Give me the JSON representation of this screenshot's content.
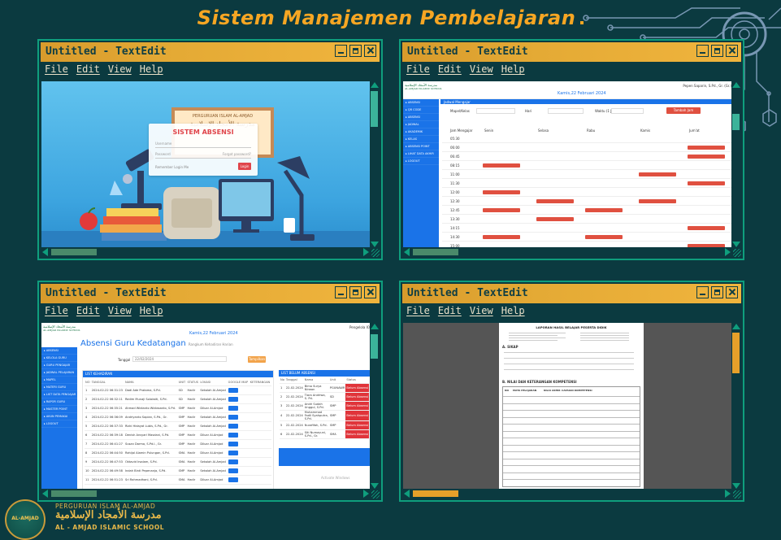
{
  "page": {
    "title": "Sistem Manajemen Pembelajaran"
  },
  "windows": [
    {
      "title": "Untitled - TextEdit",
      "menu": [
        "File",
        "Edit",
        "View",
        "Help"
      ]
    },
    {
      "title": "Untitled - TextEdit",
      "menu": [
        "File",
        "Edit",
        "View",
        "Help"
      ]
    },
    {
      "title": "Untitled - TextEdit",
      "menu": [
        "File",
        "Edit",
        "View",
        "Help"
      ]
    },
    {
      "title": "Untitled - TextEdit",
      "menu": [
        "File",
        "Edit",
        "View",
        "Help"
      ]
    }
  ],
  "login": {
    "cert_label": "PERGURUAN ISLAM AL-AMJAD",
    "cert_arabic": "مدرسة الأمجاد الإسلامية",
    "title": "SISTEM ABSENSI",
    "username_placeholder": "Username",
    "password_placeholder": "Password",
    "forgot": "Forgot password?",
    "remember": "Remember Login Me",
    "button": "Login"
  },
  "schedule": {
    "school_arabic": "مدرسة الأمجاد الإسلامية",
    "school_latin": "AL-AMJAD ISLAMIC SCHOOL",
    "date": "Kamis,22 Februari 2024",
    "user": "Pepen Saparin, S.Pd., Gr. (Gr.)",
    "tab": "Jadwal Mengajar",
    "filter_labels": [
      "Mapel/Kelas",
      "Hari",
      "Waktu (1 Jam)"
    ],
    "add_button": "Tambah Jam Mengajar",
    "columns": [
      "Jam Mengajar",
      "Senin",
      "Selasa",
      "Rabu",
      "Kamis",
      "Jum'at"
    ],
    "times": [
      "05:30",
      "06:00",
      "06:45",
      "08:15",
      "11:00",
      "11:30",
      "12:00",
      "12:30",
      "12:45",
      "13:30",
      "14:15",
      "14:30",
      "15:00"
    ],
    "sidebar": [
      "ABSENSI",
      "QR CODE",
      "ABSENSI",
      "JADWAL",
      "AKADEMIK",
      "KELAS",
      "ABSENSI POINT",
      "LIHAT DATA AKHIR",
      "LOGOUT"
    ]
  },
  "attendance": {
    "heading": "Absensi Guru Kedatangan",
    "subheading": "Rangkum Kehadiran Harian",
    "date": "Kamis,22 Februari 2024",
    "user": "Pengelola IO",
    "filter_label": "Tanggal",
    "filter_value": "22/02/2024",
    "filter_button": "Tampilkan",
    "sidebar": [
      "ABSENSI",
      "KELOLA GURU",
      "GURU PENGAJAR",
      "JADWAL PELAJARAN",
      "MAPEL",
      "MATERI GURU",
      "LIST DATA PENGAJAR",
      "RAPOR GURU",
      "MASTER POINT",
      "AKUN PEMAKAI",
      "LOGOUT"
    ],
    "left_panel_title": "LIST KEHADIRAN",
    "left_columns": [
      "NO",
      "TANGGAL",
      "NAMA",
      "UNIT",
      "STATUS",
      "LOKASI",
      "GOOGLE MAP",
      "KETERANGAN"
    ],
    "left_rows": [
      [
        "1",
        "2024-02-22 06:31:23",
        "Dadi Ade Pratama, S.Pd.",
        "SD",
        "Hadir",
        "Sekolah Al-Amjad"
      ],
      [
        "2",
        "2024-02-22 06:32:11",
        "Redim Munaji Solaiwiti, S.Pd.",
        "SD",
        "Hadir",
        "Sekolah Al-Amjad"
      ],
      [
        "3",
        "2024-02-22 06:35:21",
        "Ahmad Widianto Widiasanto, S.Pd.",
        "SMP",
        "Hadir",
        "Diluar Al-Amjad"
      ],
      [
        "4",
        "2024-02-22 06:36:09",
        "Andriyanto Sopian, S.Pd., Gr.",
        "SMP",
        "Hadir",
        "Sekolah Al-Amjad"
      ],
      [
        "5",
        "2024-02-22 06:37:33",
        "Rizki Hidayat Lubis, S.Pd., Gr.",
        "SMP",
        "Hadir",
        "Sekolah Al-Amjad"
      ],
      [
        "6",
        "2024-02-22 06:39:18",
        "Denish Ansyari Masdani, S.Pd.",
        "SMP",
        "Hadir",
        "Diluar Al-Amjad"
      ],
      [
        "7",
        "2024-02-22 06:41:27",
        "Susan Darma, S.Pd.I., Gr.",
        "SMP",
        "Hadir",
        "Diluar Al-Amjad"
      ],
      [
        "8",
        "2024-02-22 06:44:50",
        "Rahijal Alamin Pulungan, S.Pd.",
        "SMA",
        "Hadir",
        "Diluar Al-Amjad"
      ],
      [
        "9",
        "2024-02-22 06:47:53",
        "Oktavid Irsalam, S.Pd.",
        "SMA",
        "Hadir",
        "Sekolah Al-Amjad"
      ],
      [
        "10",
        "2024-02-22 06:49:58",
        "Indah Binti Pepenanja, S.Pd.",
        "SMP",
        "Hadir",
        "Sekolah Al-Amjad"
      ],
      [
        "11",
        "2024-02-22 06:51:23",
        "Sri Rahmadhani, S.Pd.",
        "SMA",
        "Hadir",
        "Diluar Al-Amjad"
      ]
    ],
    "right_panel_title": "LIST BELUM ABSENSI",
    "right_columns": [
      "No",
      "Tanggal",
      "Nama",
      "Unit",
      "Status"
    ],
    "right_rows": [
      [
        "1",
        "22-02-2024",
        "Bima Surya Nirwan",
        "PGUNAWR",
        "Belum Absensi"
      ],
      [
        "2",
        "22-02-2024",
        "Tiara Andriwa, S. Pd.",
        "SD",
        "Belum Absensi"
      ],
      [
        "3",
        "22-02-2024",
        "Andri Sudah Unggul, S.Pd.",
        "SMP",
        "Belum Absensi"
      ],
      [
        "4",
        "22-02-2024",
        "Muhammad Fadli Syahputra, S.Pd.",
        "SMP",
        "Belum Absensi"
      ],
      [
        "5",
        "22-02-2024",
        "Nurafifah, S.Pd.",
        "SMP",
        "Belum Absensi"
      ],
      [
        "6",
        "22-02-2024",
        "Siti Numayuni, S.Pd., Gr.",
        "SMA",
        "Belum Absensi"
      ]
    ],
    "watermark": "Activate Windows"
  },
  "report": {
    "title": "LAPORAN HASIL BELAJAR PESERTA DIDIK",
    "section1": "A. SIKAP",
    "section2": "B. NILAI DAN KETERANGAN KOMPETENSI",
    "columns": [
      "NO",
      "MATA PELAJARAN",
      "NILAI AKHIR",
      "CAPAIAN KOMPETENSI"
    ]
  },
  "footer": {
    "seal_text": "AL-AMJAD",
    "line1": "PERGURUAN ISLAM AL-AMJAD",
    "line2_arabic": "مدرسة الأمجاد الإسلامية",
    "line3": "AL - AMJAD ISLAMIC SCHOOL"
  },
  "colors": {
    "accent": "#f6a623",
    "background": "#0b3a40",
    "window_border": "#0f9e7d",
    "titlebar": "#e4aa35",
    "blue": "#1a73e8",
    "red": "#e05040"
  }
}
